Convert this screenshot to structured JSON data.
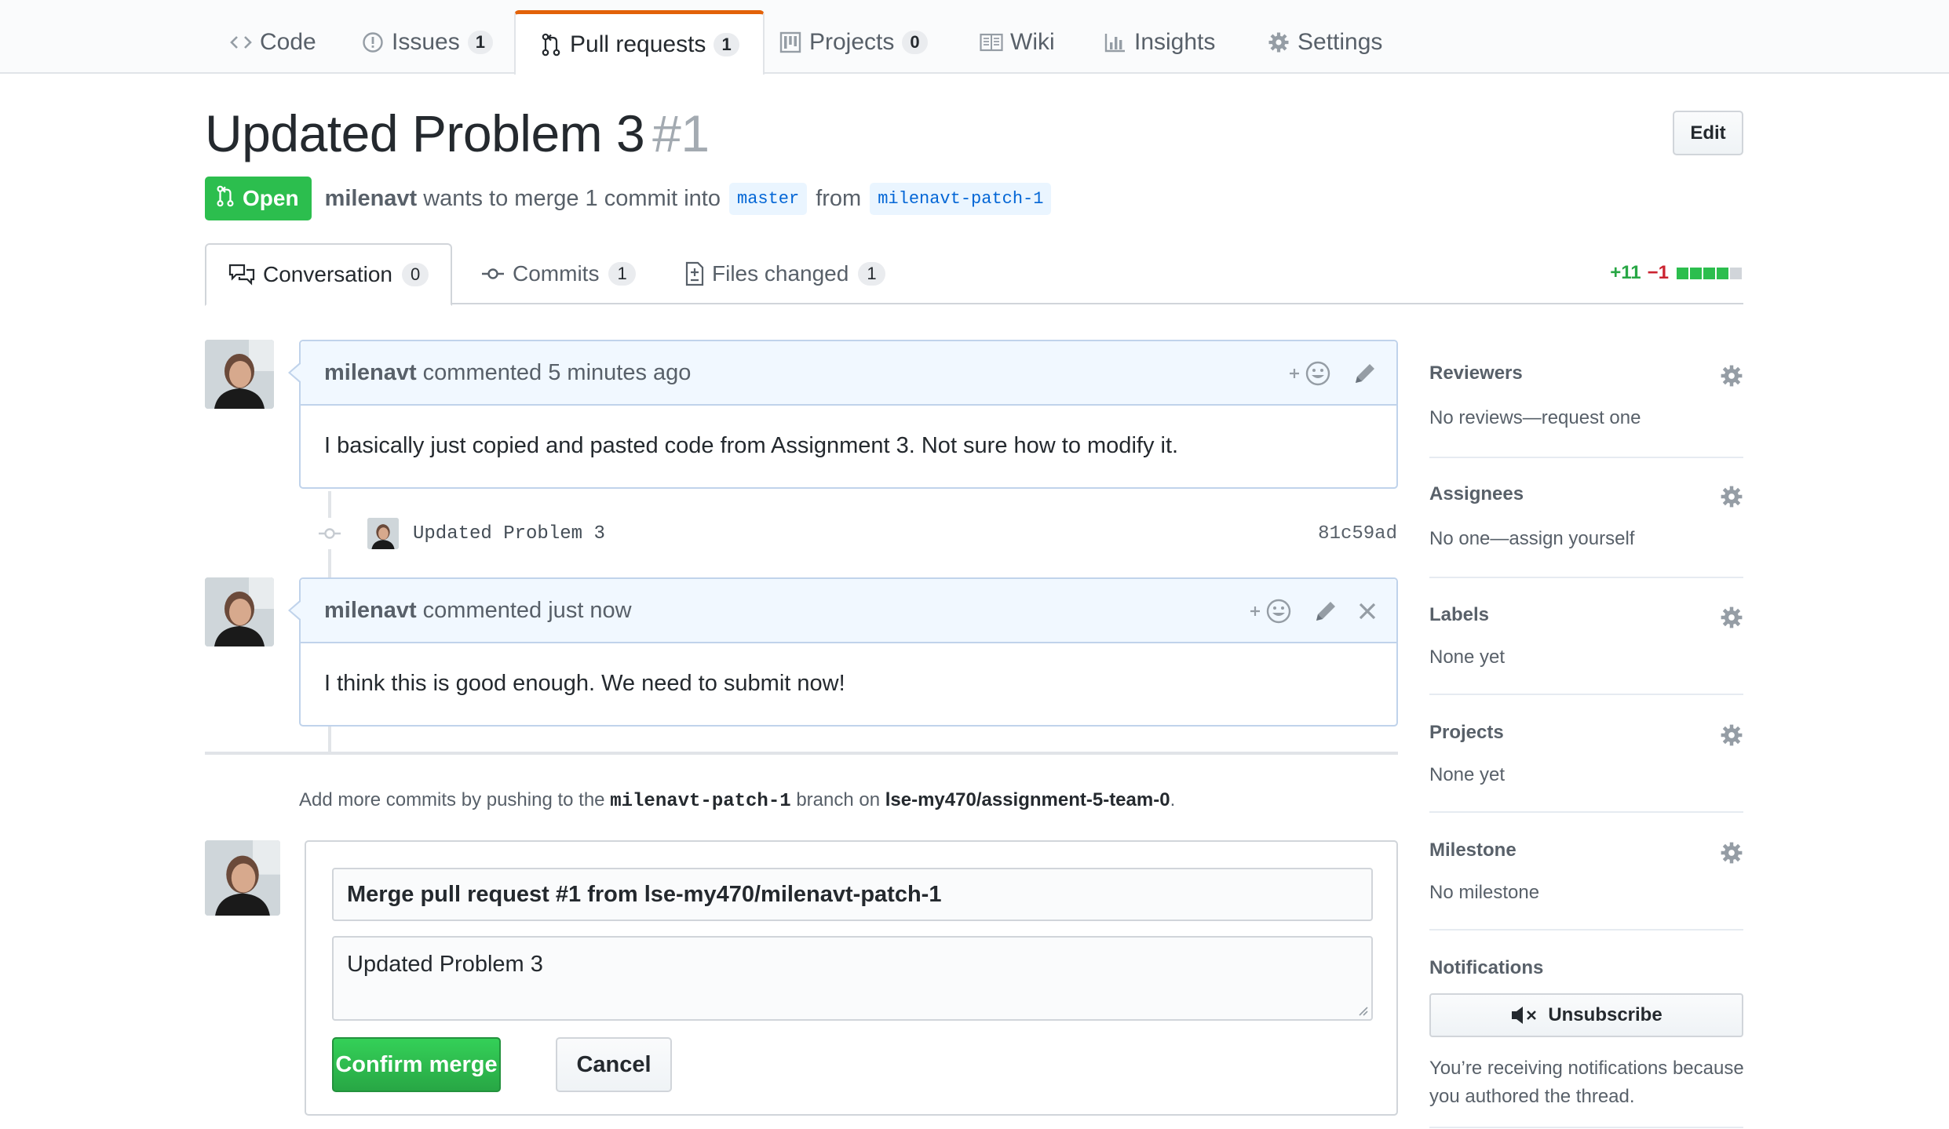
{
  "repo_nav": {
    "code": "Code",
    "issues": "Issues",
    "issues_count": "1",
    "pulls": "Pull requests",
    "pulls_count": "1",
    "projects": "Projects",
    "projects_count": "0",
    "wiki": "Wiki",
    "insights": "Insights",
    "settings": "Settings"
  },
  "pr": {
    "title": "Updated Problem 3",
    "number": "#1",
    "edit_label": "Edit",
    "state": "Open",
    "author": "milenavt",
    "merge_text": "wants to merge 1 commit into",
    "base_branch": "master",
    "from_text": "from",
    "head_branch": "milenavt-patch-1"
  },
  "pr_tabs": {
    "conversation": "Conversation",
    "conversation_count": "0",
    "commits": "Commits",
    "commits_count": "1",
    "files": "Files changed",
    "files_count": "1",
    "additions": "+11",
    "deletions": "−1",
    "diff_blocks": [
      "#2cbe4e",
      "#2cbe4e",
      "#2cbe4e",
      "#2cbe4e",
      "#d1d5da"
    ]
  },
  "comments": [
    {
      "author": "milenavt",
      "action": "commented 5 minutes ago",
      "body": "I basically just copied and pasted code from Assignment 3. Not sure how to modify it."
    },
    {
      "author": "milenavt",
      "action": "commented just now",
      "body": "I think this is good enough. We need to submit now!"
    }
  ],
  "commit": {
    "message": "Updated Problem 3",
    "sha": "81c59ad"
  },
  "hint": {
    "prefix": "Add more commits by pushing to the",
    "branch": "milenavt-patch-1",
    "middle": "branch on",
    "repo": "lse-my470/assignment-5-team-0",
    "suffix": "."
  },
  "merge": {
    "title_value": "Merge pull request #1 from lse-my470/milenavt-patch-1",
    "message_value": "Updated Problem 3",
    "confirm_label": "Confirm merge",
    "cancel_label": "Cancel"
  },
  "sidebar": {
    "reviewers_title": "Reviewers",
    "reviewers_value": "No reviews—request one",
    "assignees_title": "Assignees",
    "assignees_value": "No one—assign yourself",
    "labels_title": "Labels",
    "labels_value": "None yet",
    "projects_title": "Projects",
    "projects_value": "None yet",
    "milestone_title": "Milestone",
    "milestone_value": "No milestone",
    "notifications_title": "Notifications",
    "unsubscribe_label": "Unsubscribe",
    "notifications_note": "You’re receiving notifications because you authored the thread."
  },
  "colors": {
    "open_green": "#2cbe4e",
    "tab_accent": "#e36209",
    "comment_header": "#f1f8ff",
    "branch_bg": "#eaf5ff"
  }
}
